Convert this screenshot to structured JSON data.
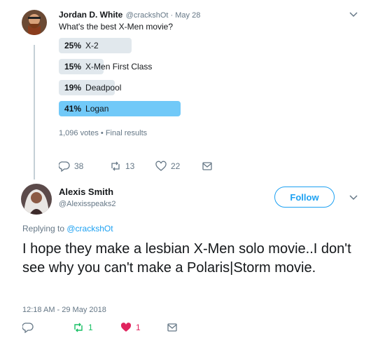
{
  "parent_tweet": {
    "author_name": "Jordan D. White",
    "handle_time": "@crackshOt · May 28",
    "text": "What's the best X-Men movie?",
    "poll": {
      "options": [
        {
          "pct": "25%",
          "label": "X-2",
          "value": 25
        },
        {
          "pct": "15%",
          "label": "X-Men First Class",
          "value": 15
        },
        {
          "pct": "19%",
          "label": "Deadpool",
          "value": 19
        },
        {
          "pct": "41%",
          "label": "Logan",
          "value": 41
        }
      ],
      "summary": "1,096 votes • Final results"
    },
    "actions": {
      "replies": "38",
      "retweets": "13",
      "likes": "22"
    }
  },
  "reply_tweet": {
    "author_name": "Alexis Smith",
    "handle": "@Alexisspeaks2",
    "follow_label": "Follow",
    "replying_prefix": "Replying to ",
    "replying_handle": "@crackshOt",
    "text": "I hope they make a lesbian X-Men solo movie..I don't see why you can't make a Polaris|Storm movie.",
    "timestamp": "12:18 AM - 29 May 2018",
    "actions": {
      "retweets": "1",
      "likes": "1"
    }
  },
  "colors": {
    "accent": "#1da1f2",
    "like": "#e0245e",
    "retweet": "#17bf63",
    "poll_winner": "#71c9f8",
    "poll_bar": "#e1e8ed"
  },
  "icons": [
    "reply-icon",
    "retweet-icon",
    "like-icon",
    "message-icon",
    "chevron-down-icon"
  ]
}
